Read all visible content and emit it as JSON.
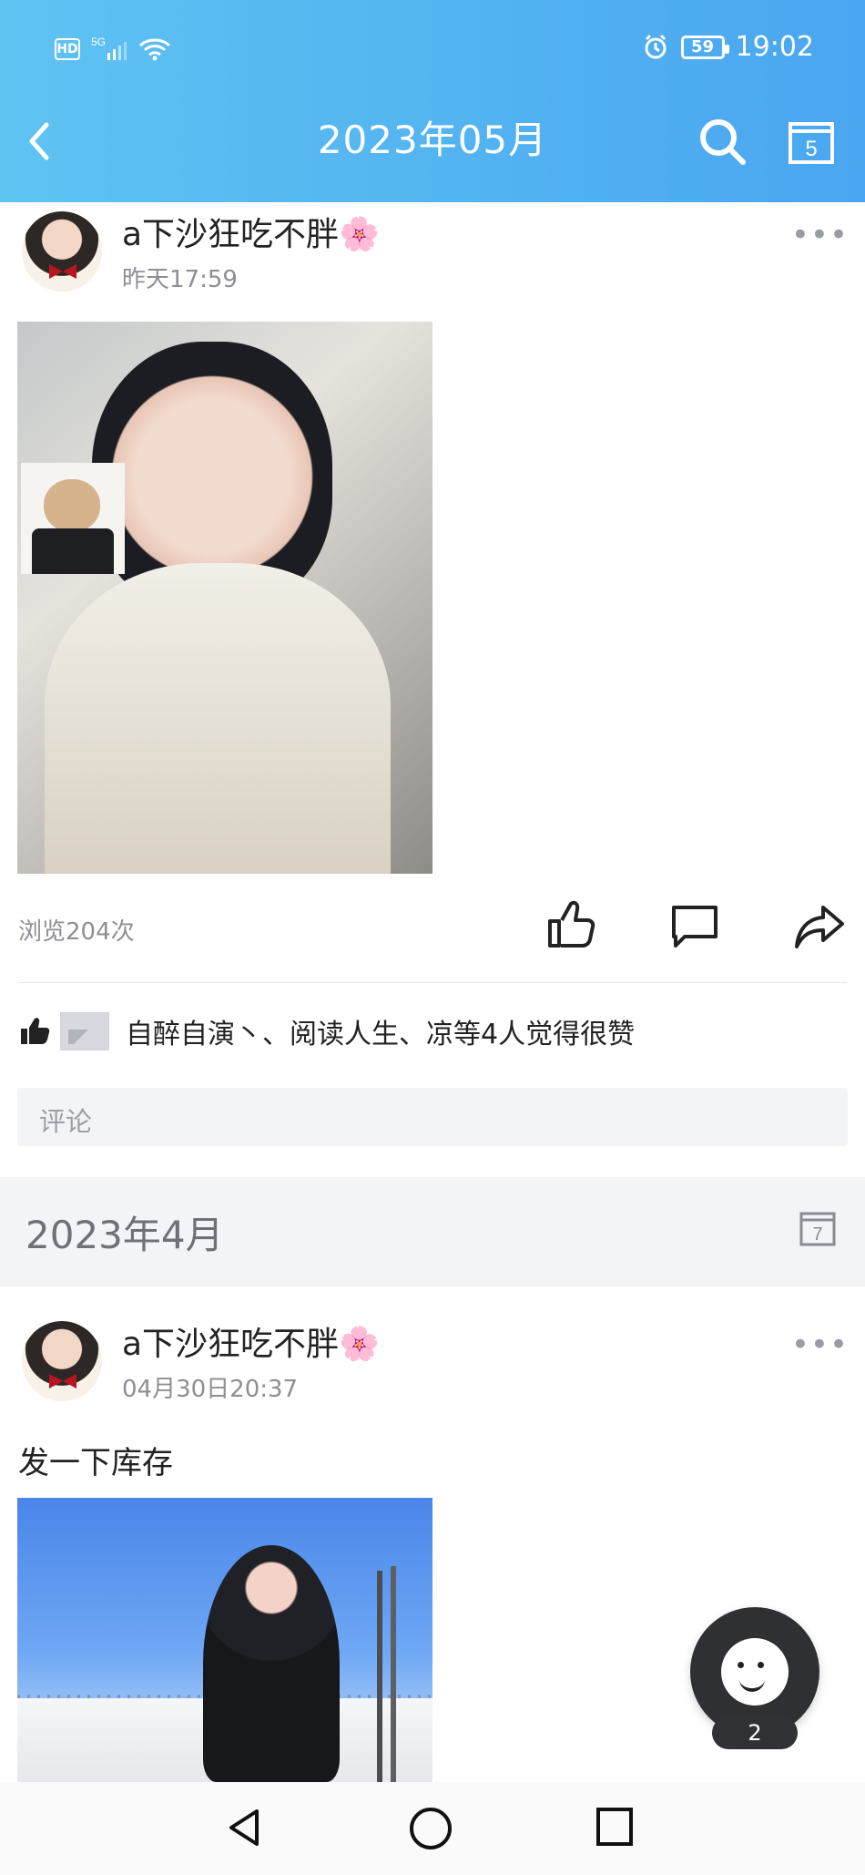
{
  "status": {
    "network_badge": "HD",
    "signal": "5G",
    "battery": "59",
    "time": "19:02"
  },
  "header": {
    "title": "2023年05月"
  },
  "posts": [
    {
      "author": "a下沙狂吃不胖🌸",
      "time": "昨天17:59",
      "views": "浏览204次",
      "likes_text": "自醉自演丶、阅读人生、凉等4人觉得很赞",
      "comment_placeholder": "评论"
    },
    {
      "author": "a下沙狂吃不胖🌸",
      "time": "04月30日20:37",
      "text": "发一下库存"
    }
  ],
  "month_section": {
    "label": "2023年4月",
    "calendar_day": "7"
  },
  "header_calendar_day": "5",
  "floating_badge": "2",
  "icons": {
    "back": "back-icon",
    "search": "search-icon",
    "calendar": "calendar-icon",
    "more": "more-icon",
    "like": "like-icon",
    "comment": "comment-icon",
    "share": "share-icon"
  },
  "colors": {
    "header_start": "#5fc3f2",
    "header_end": "#4aa6f0"
  }
}
